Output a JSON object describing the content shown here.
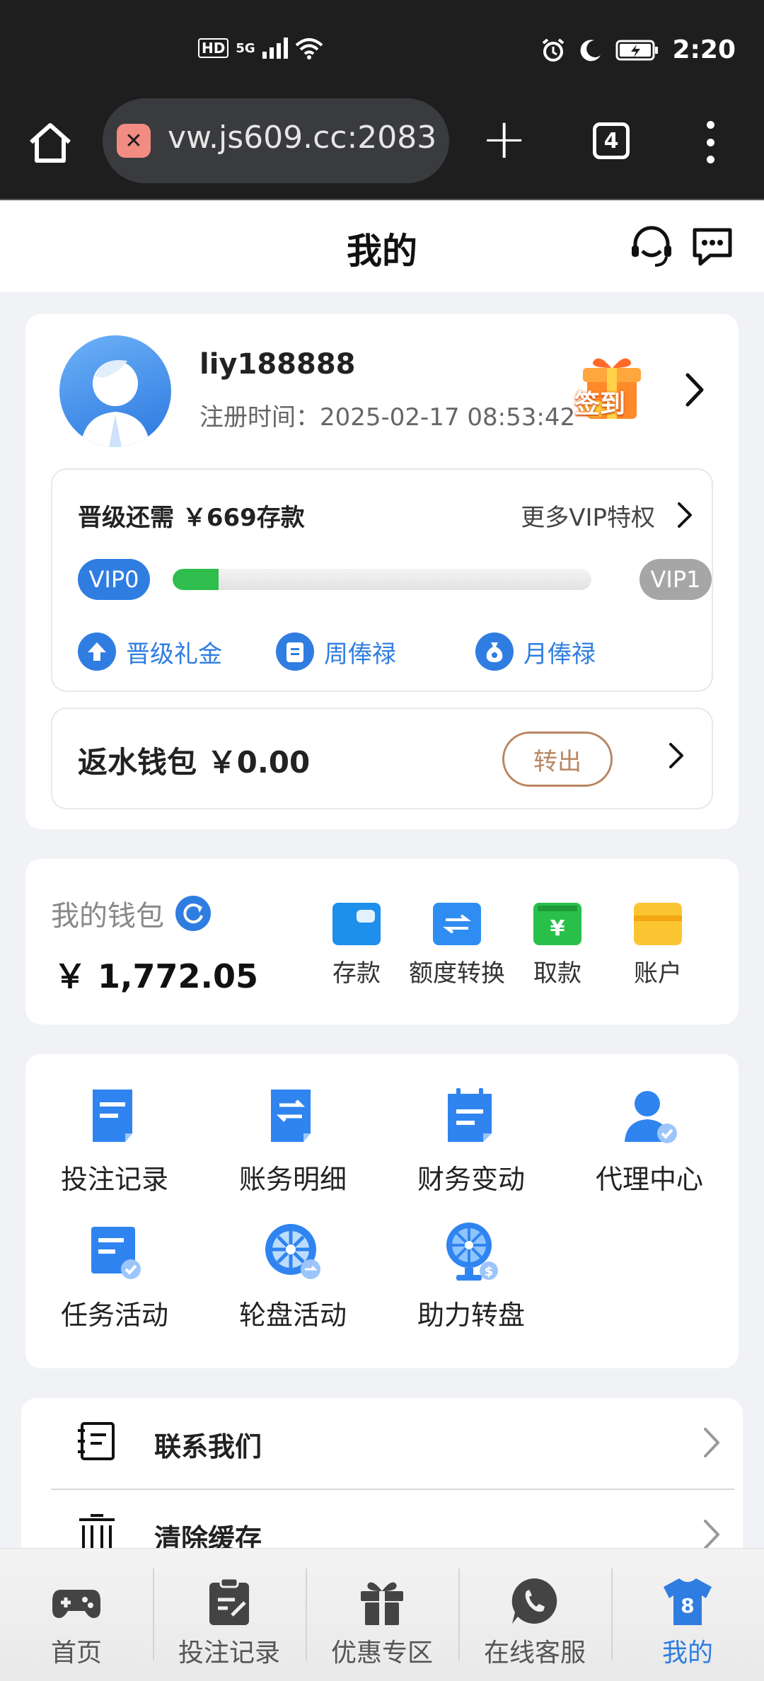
{
  "status_bar": {
    "left_badges": [
      "HD",
      "5G"
    ],
    "time": "2:20"
  },
  "browser": {
    "url": "vw.js609.cc:2083",
    "tab_count": "4"
  },
  "header": {
    "title": "我的"
  },
  "profile": {
    "username": "liy188888",
    "register_time": "注册时间：2025-02-17 08:53:42",
    "signin_label": "签到"
  },
  "vip": {
    "upgrade_need": "晋级还需 ￥669存款",
    "more_label": "更多VIP特权",
    "current_level": "VIP0",
    "next_level": "VIP1",
    "progress_fraction": 0.11,
    "perks": [
      "晋级礼金",
      "周俸禄",
      "月俸禄"
    ]
  },
  "rebate": {
    "label": "返水钱包 ￥0.00",
    "button_label": "转出"
  },
  "wallet": {
    "title": "我的钱包",
    "amount": "￥ 1,772.05",
    "actions": [
      "存款",
      "额度转换",
      "取款",
      "账户"
    ]
  },
  "grid": {
    "items": [
      "投注记录",
      "账务明细",
      "财务变动",
      "代理中心",
      "任务活动",
      "轮盘活动",
      "助力转盘"
    ]
  },
  "list": {
    "items": [
      "联系我们",
      "清除缓存"
    ]
  },
  "bottom_nav": {
    "items": [
      "首页",
      "投注记录",
      "优惠专区",
      "在线客服",
      "我的"
    ],
    "active_badge": "8"
  },
  "colors": {
    "accent": "#2f7de1",
    "progress": "#2fbd4d",
    "transfer_button": "#b98662"
  }
}
